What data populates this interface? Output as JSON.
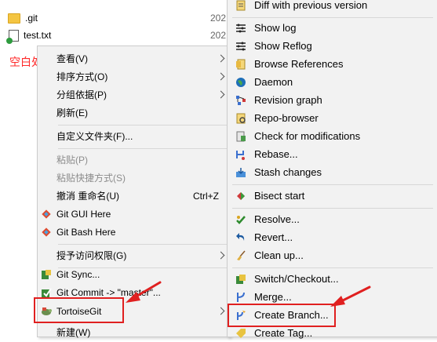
{
  "files": [
    {
      "name": ".git",
      "date": "202"
    },
    {
      "name": "test.txt",
      "date": "202"
    }
  ],
  "annotation": "空白处右键",
  "context_menu": {
    "items": [
      {
        "label": "查看(V)",
        "submenu": true
      },
      {
        "label": "排序方式(O)",
        "submenu": true
      },
      {
        "label": "分组依据(P)",
        "submenu": true
      },
      {
        "label": "刷新(E)"
      },
      {
        "label": "自定义文件夹(F)..."
      },
      {
        "label": "粘贴(P)"
      },
      {
        "label": "粘贴快捷方式(S)"
      },
      {
        "label": "撤消 重命名(U)",
        "shortcut": "Ctrl+Z"
      },
      {
        "label": "Git GUI Here"
      },
      {
        "label": "Git Bash Here"
      },
      {
        "label": "授予访问权限(G)",
        "submenu": true
      },
      {
        "label": "Git Sync..."
      },
      {
        "label": "Git Commit -> \"master\"..."
      },
      {
        "label": "TortoiseGit",
        "submenu": true
      },
      {
        "label": "新建(W)"
      }
    ]
  },
  "tortoisegit_submenu": {
    "items": [
      {
        "label": "Diff with previous version"
      },
      {
        "label": "Show log"
      },
      {
        "label": "Show Reflog"
      },
      {
        "label": "Browse References"
      },
      {
        "label": "Daemon"
      },
      {
        "label": "Revision graph"
      },
      {
        "label": "Repo-browser"
      },
      {
        "label": "Check for modifications"
      },
      {
        "label": "Rebase..."
      },
      {
        "label": "Stash changes"
      },
      {
        "label": "Bisect start"
      },
      {
        "label": "Resolve..."
      },
      {
        "label": "Revert..."
      },
      {
        "label": "Clean up..."
      },
      {
        "label": "Switch/Checkout..."
      },
      {
        "label": "Merge..."
      },
      {
        "label": "Create Branch..."
      },
      {
        "label": "Create Tag..."
      }
    ]
  },
  "colors": {
    "highlight": "#e02020",
    "annotation": "#ff2a2a"
  }
}
